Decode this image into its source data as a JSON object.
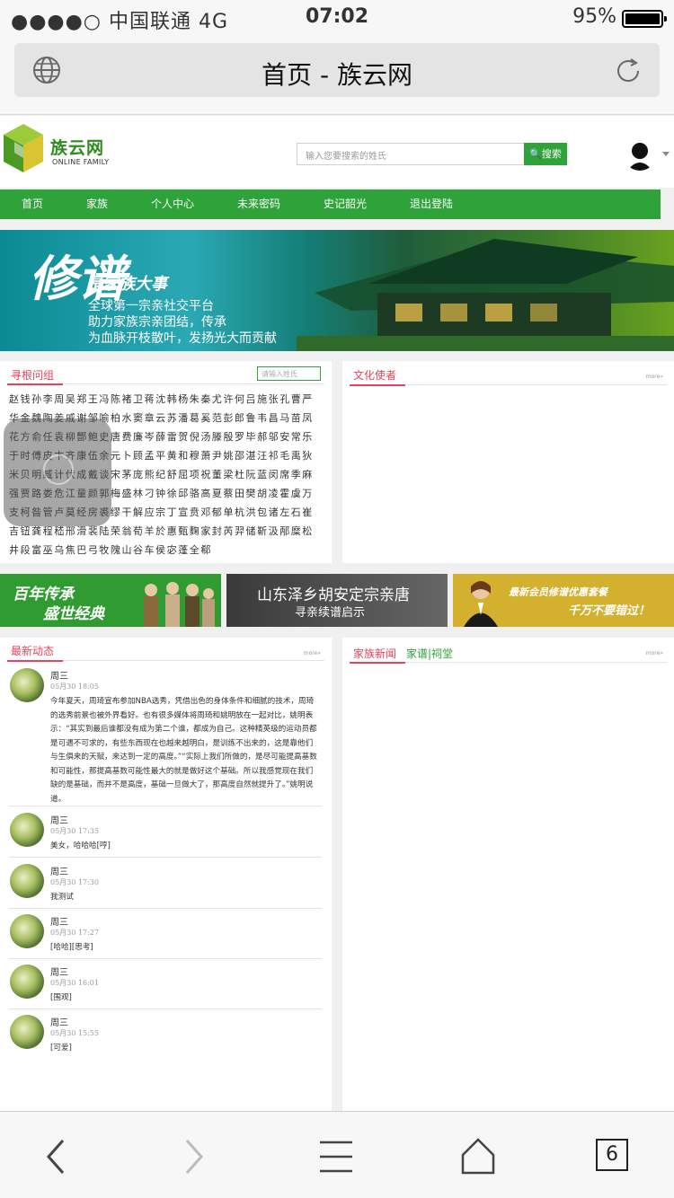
{
  "status": {
    "carrier": "●●●●○ 中国联通  4G",
    "time": "07:02",
    "battery": "95%"
  },
  "browser": {
    "title": "首页 - 族云网",
    "tab_count": "6"
  },
  "site": {
    "logo_name": "族云网",
    "logo_sub": "ONLINE FAMILY",
    "search_placeholder": "输入您要搜索的姓氏",
    "search_button": "搜索",
    "nav": [
      "首页",
      "家族",
      "个人中心",
      "未来密码",
      "史记韶光",
      "退出登陆"
    ]
  },
  "banner": {
    "big": "修谱",
    "slogan": "是家族大事",
    "lines": [
      "全球第一宗亲社交平台",
      "助力家族宗亲团结，传承",
      "为血脉开枝散叶，发扬光大而贡献"
    ]
  },
  "xungen": {
    "title": "寻根问组",
    "input_placeholder": "请输入姓氏",
    "surnames": "赵钱孙李周吴郑王冯陈褚卫蒋沈韩杨朱秦尤许何吕施张孔曹严华金魏陶姜戚谢邹喻柏水窦章云苏潘葛奚范彭郎鲁韦昌马苗凤花方俞任袁柳酆鲍史唐费廉岑薛雷贺倪汤滕殷罗毕郝邬安常乐于时傅皮卞齐康伍余元卜顾孟平黄和穆萧尹姚邵湛汪祁毛禹狄米贝明臧计伏成戴谈宋茅庞熊纪舒屈项祝董梁杜阮蓝闵席季麻强贾路娄危江童颜郭梅盛林刁钟徐邱骆高夏蔡田樊胡凌霍虞万支柯昝管卢莫经房裘缪干解应宗丁宣贲邓郁单杭洪包诸左石崔吉钮龚程嵇邢滑裴陆荣翁荀羊於惠甄麴家封芮羿储靳汲邴糜松井段富巫乌焦巴弓牧隗山谷车侯宓蓬全郗"
  },
  "culture": {
    "title": "文化使者",
    "more": "more»"
  },
  "ads": {
    "ad1_line1": "百年传承",
    "ad1_line2": "盛世经典",
    "ad2_line1": "山东泽乡胡安定宗亲唐",
    "ad2_line2": "寻亲续谱启示",
    "ad3_line1": "最新会员修谱优惠套餐",
    "ad3_line2": "千万不要错过！"
  },
  "feed": {
    "title": "最新动态",
    "more": "more»",
    "items": [
      {
        "name": "周三",
        "time": "05月30 18:05",
        "text": "今年夏天，周琦宣布参加NBA选秀，凭借出色的身体条件和细腻的技术，周琦的选秀前景也被外界看好。也有很多媒体将周琦和姚明放在一起对比，姚明表示：“其实到最后谁都没有成为第二个谁，都成为自己。这种精英级的运动员都是可遇不可求的，有些东西现在也越来越明白，是训练不出来的，这是靠他们与生俱来的天赋，来达到一定的高度。”“实际上我们所做的，是尽可能提高基数和可能性，那提高基数可能性最大的就是做好这个基础。所以我感觉现在我们缺的是基础，而并不是高度，基础一旦做大了，那高度自然就提升了。”姚明说道。"
      },
      {
        "name": "周三",
        "time": "05月30 17:35",
        "text": "美女，哈哈哈[哼]"
      },
      {
        "name": "周三",
        "time": "05月30 17:30",
        "text": "我测试"
      },
      {
        "name": "周三",
        "time": "05月30 17:27",
        "text": "[哈哈][思考]"
      },
      {
        "name": "周三",
        "time": "05月30 16:01",
        "text": "[围观]"
      },
      {
        "name": "周三",
        "time": "05月30 15:55",
        "text": "[可爱]"
      }
    ]
  },
  "family_news": {
    "tab1": "家族新闻",
    "tab2": "家谱|祠堂",
    "more": "more»"
  }
}
